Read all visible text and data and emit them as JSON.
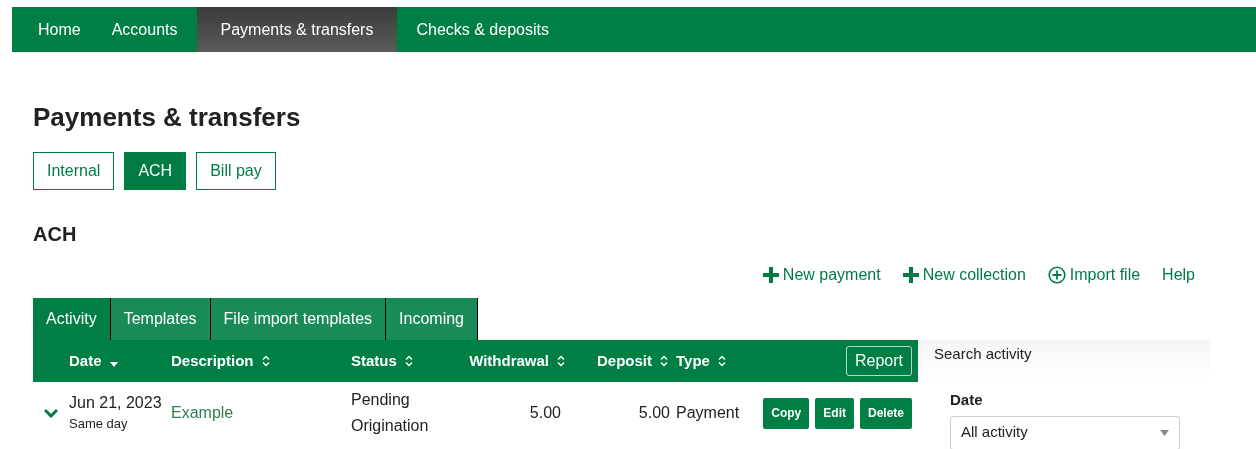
{
  "nav": [
    {
      "label": "Home",
      "selected": false
    },
    {
      "label": "Accounts",
      "selected": false
    },
    {
      "label": "Payments & transfers",
      "selected": true
    },
    {
      "label": "Checks & deposits",
      "selected": false
    }
  ],
  "page_title": "Payments & transfers",
  "section_buttons": [
    {
      "label": "Internal",
      "selected": false
    },
    {
      "label": "ACH",
      "selected": true
    },
    {
      "label": "Bill pay",
      "selected": false
    }
  ],
  "section_title": "ACH",
  "actions": [
    {
      "kind": "plus",
      "label": "New payment"
    },
    {
      "kind": "plus",
      "label": "New collection"
    },
    {
      "kind": "circle-plus",
      "label": "Import file"
    },
    {
      "kind": "plain",
      "label": "Help"
    }
  ],
  "tabs": [
    {
      "label": "Activity",
      "selected": true
    },
    {
      "label": "Templates",
      "selected": false
    },
    {
      "label": "File import templates",
      "selected": false
    },
    {
      "label": "Incoming",
      "selected": false
    }
  ],
  "table": {
    "columns": [
      {
        "label": "Date",
        "kind": "sorted"
      },
      {
        "label": "Description",
        "kind": "sortable"
      },
      {
        "label": "Status",
        "kind": "sortable"
      },
      {
        "label": "Withdrawal",
        "kind": "sortable"
      },
      {
        "label": "Deposit",
        "kind": "sortable"
      },
      {
        "label": "Type",
        "kind": "sortable"
      }
    ],
    "report_button": "Report",
    "rows": [
      {
        "expanded": false,
        "date": "Jun 21, 2023",
        "timing": "Same day",
        "description": "Example",
        "status": "Pending Origination",
        "withdrawal": "5.00",
        "deposit": "5.00",
        "type": "Payment",
        "buttons": [
          "Copy",
          "Edit",
          "Delete"
        ]
      }
    ]
  },
  "search": {
    "title": "Search activity",
    "date_label": "Date",
    "date_value": "All activity"
  }
}
